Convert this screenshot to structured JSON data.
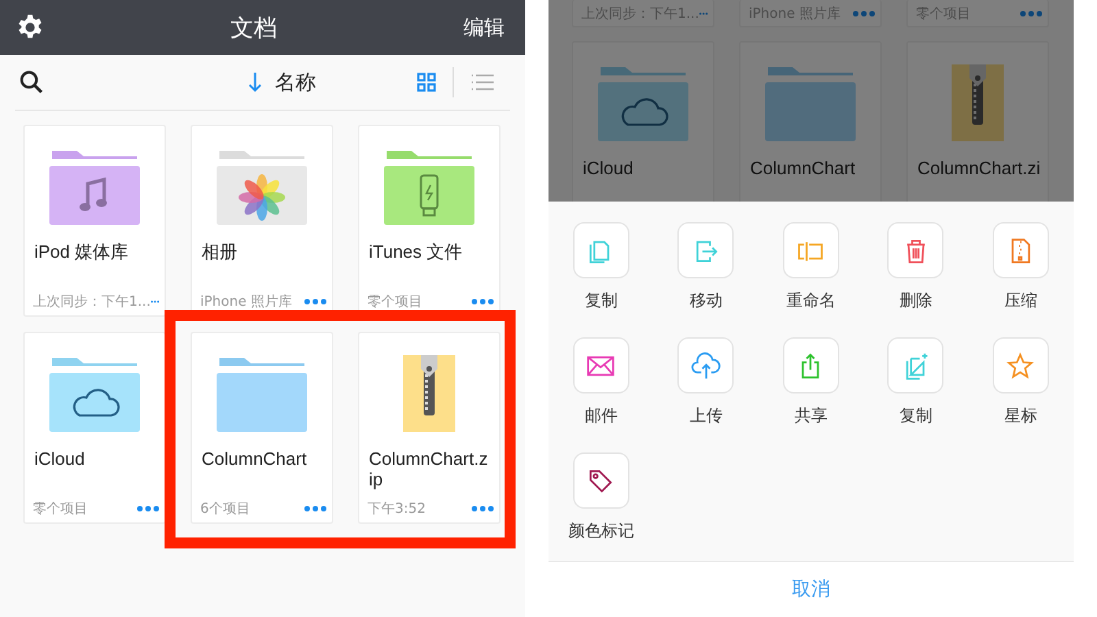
{
  "left": {
    "header": {
      "title": "文档",
      "edit": "编辑"
    },
    "toolbar": {
      "sort_label": "名称",
      "grid_selected": true
    },
    "items": [
      {
        "kind": "music",
        "name": "iPod 媒体库",
        "detail": "上次同步：下午1...",
        "highlighted": false
      },
      {
        "kind": "photos",
        "name": "相册",
        "detail": "iPhone 照片库",
        "highlighted": false
      },
      {
        "kind": "usb",
        "name": "iTunes 文件",
        "detail": "零个项目",
        "highlighted": false
      },
      {
        "kind": "cloud",
        "name": "iCloud",
        "detail": "零个项目",
        "highlighted": false
      },
      {
        "kind": "folder",
        "name": "ColumnChart",
        "detail": "6个项目",
        "highlighted": true
      },
      {
        "kind": "zip",
        "name": "ColumnChart.zip",
        "detail": "下午3:52",
        "highlighted": true
      }
    ]
  },
  "right": {
    "background_details": [
      "上次同步：下午1...",
      "iPhone 照片库",
      "零个项目"
    ],
    "background_items": [
      {
        "kind": "cloud",
        "name": "iCloud"
      },
      {
        "kind": "folder",
        "name": "ColumnChart"
      },
      {
        "kind": "zip",
        "name": "ColumnChart.zi"
      }
    ],
    "actions": [
      {
        "kind": "copy",
        "label": "复制"
      },
      {
        "kind": "move",
        "label": "移动"
      },
      {
        "kind": "rename",
        "label": "重命名"
      },
      {
        "kind": "delete",
        "label": "删除"
      },
      {
        "kind": "compress",
        "label": "压缩"
      },
      {
        "kind": "mail",
        "label": "邮件"
      },
      {
        "kind": "upload",
        "label": "上传"
      },
      {
        "kind": "share",
        "label": "共享"
      },
      {
        "kind": "duplicate",
        "label": "复制"
      },
      {
        "kind": "star",
        "label": "星标"
      },
      {
        "kind": "tag",
        "label": "颜色标记"
      }
    ],
    "cancel": "取消"
  }
}
